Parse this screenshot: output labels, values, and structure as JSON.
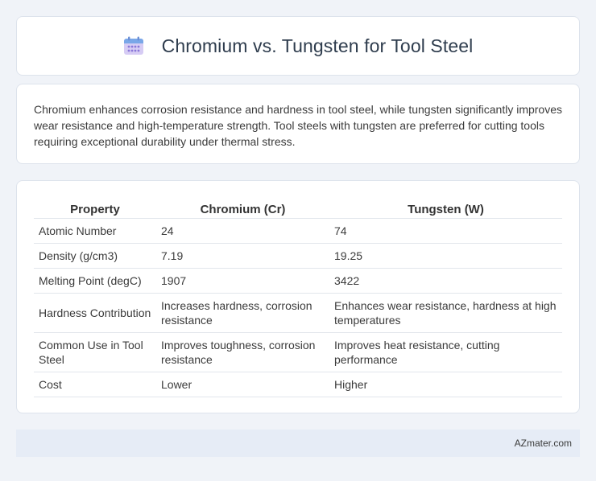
{
  "header": {
    "title": "Chromium vs. Tungsten for Tool Steel",
    "icon": "calendar-icon",
    "icon_colors": {
      "top": "#7aa7e8",
      "body": "#c9bdf0",
      "dots": "#8b78d9"
    }
  },
  "description": "Chromium enhances corrosion resistance and hardness in tool steel, while tungsten significantly improves wear resistance and high-temperature strength. Tool steels with tungsten are preferred for cutting tools requiring exceptional durability under thermal stress.",
  "table": {
    "headers": [
      "Property",
      "Chromium (Cr)",
      "Tungsten (W)"
    ],
    "rows": [
      [
        "Atomic Number",
        "24",
        "74"
      ],
      [
        "Density (g/cm3)",
        "7.19",
        "19.25"
      ],
      [
        "Melting Point (degC)",
        "1907",
        "3422"
      ],
      [
        "Hardness Contribution",
        "Increases hardness, corrosion resistance",
        "Enhances wear resistance, hardness at high temperatures"
      ],
      [
        "Common Use in Tool Steel",
        "Improves toughness, corrosion resistance",
        "Improves heat resistance, cutting performance"
      ],
      [
        "Cost",
        "Lower",
        "Higher"
      ]
    ]
  },
  "footer": {
    "site": "AZmater.com"
  }
}
